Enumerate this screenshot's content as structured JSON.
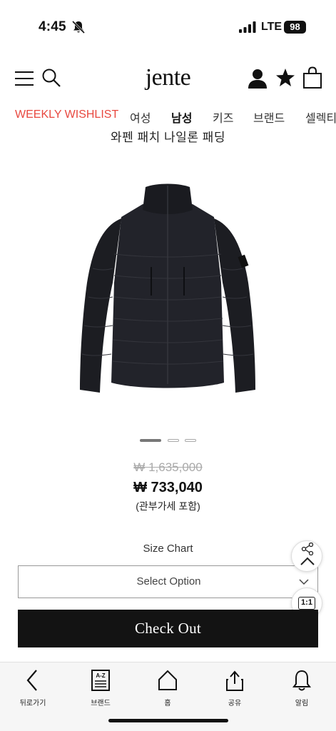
{
  "status_bar": {
    "time": "4:45",
    "network": "LTE",
    "battery": "98"
  },
  "header": {
    "logo": "jente"
  },
  "nav": {
    "items": [
      {
        "label": "WEEKLY WISHLIST"
      },
      {
        "label": "여성"
      },
      {
        "label": "남성"
      },
      {
        "label": "키즈"
      },
      {
        "label": "브랜드"
      },
      {
        "label": "셀렉티"
      }
    ],
    "active": "남성",
    "highlight_color": "#e8483f"
  },
  "product": {
    "title": "와펜 패치 나일론 패딩",
    "original_price": "₩ 1,635,000",
    "sale_price": "₩ 733,040",
    "tax_note": "(관부가세 포함)",
    "carousel": {
      "current": 1,
      "total": 3
    }
  },
  "options": {
    "size_chart_label": "Size Chart",
    "select_placeholder": "Select Option"
  },
  "floating": {
    "ratio_label": "1:1"
  },
  "checkout": {
    "label": "Check Out"
  },
  "bottom_nav": {
    "items": [
      {
        "label": "뒤로가기",
        "icon": "back-arrow-icon"
      },
      {
        "label": "브랜드",
        "icon": "brand-az-icon"
      },
      {
        "label": "홈",
        "icon": "home-icon"
      },
      {
        "label": "공유",
        "icon": "share-icon"
      },
      {
        "label": "알림",
        "icon": "bell-icon"
      }
    ]
  }
}
